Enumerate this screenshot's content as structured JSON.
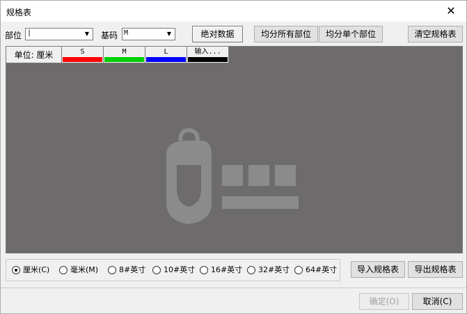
{
  "window": {
    "title": "规格表",
    "close_glyph": "✕"
  },
  "toolbar": {
    "part_label": "部位",
    "part_value": "|",
    "base_label": "基码",
    "base_value": "M",
    "absolute_btn": "绝对数据",
    "avg_all_btn": "均分所有部位",
    "avg_single_btn": "均分单个部位",
    "clear_btn": "清空规格表"
  },
  "grid": {
    "unit_label": "单位: 厘米",
    "columns": [
      {
        "label": "S",
        "color": "#ff0000"
      },
      {
        "label": "M",
        "color": "#00d000"
      },
      {
        "label": "L",
        "color": "#0000ff"
      },
      {
        "label": "输入...",
        "color": "#000000"
      }
    ],
    "background": "#6d6b6c"
  },
  "units": {
    "options": [
      "厘米(C)",
      "毫米(M)",
      "8#英寸",
      "10#英寸",
      "16#英寸",
      "32#英寸",
      "64#英寸"
    ],
    "selected": "厘米(C)"
  },
  "actions": {
    "import_btn": "导入规格表",
    "export_btn": "导出规格表",
    "ok_btn": "确定(O)",
    "cancel_btn": "取消(C)"
  }
}
